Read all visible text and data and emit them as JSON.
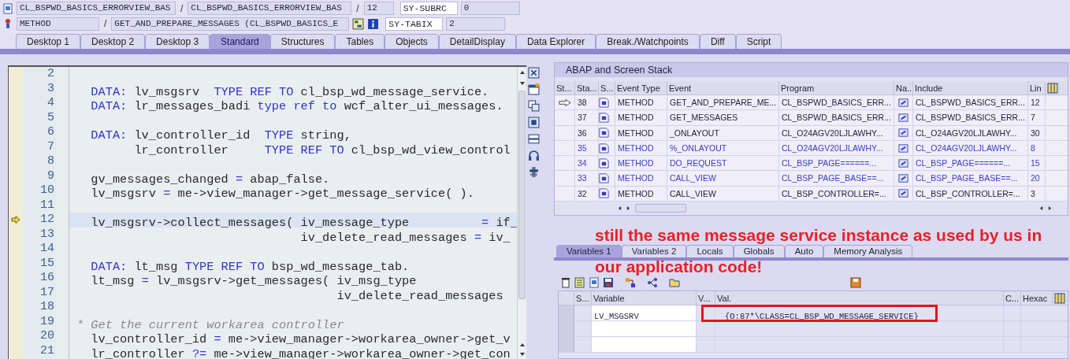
{
  "context": {
    "rows": [
      {
        "items": [
          {
            "kind": "field",
            "value": "CL_BSPWD_BASICS_ERRORVIEW_BAS"
          },
          {
            "kind": "separator",
            "value": "/"
          },
          {
            "kind": "field",
            "value": "CL_BSPWD_BASICS_ERRORVIEW_BAS"
          },
          {
            "kind": "separator",
            "value": "/"
          },
          {
            "kind": "field",
            "value": "12"
          },
          {
            "kind": "name",
            "value": "SY-SUBRC"
          },
          {
            "kind": "field",
            "value": "0"
          }
        ]
      },
      {
        "items": [
          {
            "kind": "field",
            "value": "METHOD"
          },
          {
            "kind": "separator",
            "value": "/"
          },
          {
            "kind": "field",
            "value": "GET_AND_PREPARE_MESSAGES (CL_BSPWD_BASICS_E"
          },
          {
            "kind": "tools"
          },
          {
            "kind": "name",
            "value": "SY-TABIX"
          },
          {
            "kind": "field",
            "value": "2"
          }
        ]
      }
    ]
  },
  "tabs": [
    {
      "label": "Desktop 1",
      "selected": false
    },
    {
      "label": "Desktop 2",
      "selected": false
    },
    {
      "label": "Desktop 3",
      "selected": false
    },
    {
      "label": "Standard",
      "selected": true
    },
    {
      "label": "Structures",
      "selected": false
    },
    {
      "label": "Tables",
      "selected": false
    },
    {
      "label": "Objects",
      "selected": false
    },
    {
      "label": "DetailDisplay",
      "selected": false
    },
    {
      "label": "Data Explorer",
      "selected": false
    },
    {
      "label": "Break./Watchpoints",
      "selected": false
    },
    {
      "label": "Diff",
      "selected": false
    },
    {
      "label": "Script",
      "selected": false
    }
  ],
  "editor": {
    "lines": [
      {
        "number": "2",
        "current": false
      },
      {
        "number": "3",
        "current": false,
        "segments": [
          {
            "kind": "keyword",
            "text": "  DATA:"
          },
          {
            "kind": "plain",
            "text": " lv_msgsrv  "
          },
          {
            "kind": "keyword",
            "text": "TYPE REF TO"
          },
          {
            "kind": "plain",
            "text": " cl_bsp_wd_message_service."
          }
        ]
      },
      {
        "number": "4",
        "current": false,
        "segments": [
          {
            "kind": "keyword",
            "text": "  DATA:"
          },
          {
            "kind": "plain",
            "text": " lr_messages_badi "
          },
          {
            "kind": "keyword",
            "text": "type ref to"
          },
          {
            "kind": "plain",
            "text": " wcf_alter_ui_messages."
          }
        ]
      },
      {
        "number": "5",
        "current": false
      },
      {
        "number": "6",
        "current": false,
        "segments": [
          {
            "kind": "keyword",
            "text": "  DATA:"
          },
          {
            "kind": "plain",
            "text": " lv_controller_id  "
          },
          {
            "kind": "keyword",
            "text": "TYPE"
          },
          {
            "kind": "plain",
            "text": " string,"
          }
        ]
      },
      {
        "number": "7",
        "current": false,
        "segments": [
          {
            "kind": "plain",
            "text": "        lr_controller     "
          },
          {
            "kind": "keyword",
            "text": "TYPE REF TO"
          },
          {
            "kind": "plain",
            "text": " cl_bsp_wd_view_control"
          }
        ]
      },
      {
        "number": "8",
        "current": false
      },
      {
        "number": "9",
        "current": false,
        "segments": [
          {
            "kind": "plain",
            "text": "  gv_messages_changed "
          },
          {
            "kind": "operator",
            "text": "="
          },
          {
            "kind": "plain",
            "text": " abap_false."
          }
        ]
      },
      {
        "number": "10",
        "current": false,
        "segments": [
          {
            "kind": "plain",
            "text": "  lv_msgsrv "
          },
          {
            "kind": "operator",
            "text": "="
          },
          {
            "kind": "plain",
            "text": " me->view_manager->get_message_service( )."
          }
        ]
      },
      {
        "number": "11",
        "current": false
      },
      {
        "number": "12",
        "current": true,
        "segments": [
          {
            "kind": "plain",
            "text": "  lv_msgsrv->collect_messages( iv_message_type          "
          },
          {
            "kind": "operator",
            "text": "="
          },
          {
            "kind": "plain",
            "text": " if_"
          }
        ]
      },
      {
        "number": "13",
        "current": false,
        "segments": [
          {
            "kind": "plain",
            "text": "                               iv_delete_read_messages "
          },
          {
            "kind": "operator",
            "text": "="
          },
          {
            "kind": "plain",
            "text": " iv_"
          }
        ]
      },
      {
        "number": "14",
        "current": false
      },
      {
        "number": "15",
        "current": false,
        "segments": [
          {
            "kind": "keyword",
            "text": "  DATA:"
          },
          {
            "kind": "plain",
            "text": " lt_msg "
          },
          {
            "kind": "keyword",
            "text": "TYPE REF TO"
          },
          {
            "kind": "plain",
            "text": " bsp_wd_message_tab."
          }
        ]
      },
      {
        "number": "16",
        "current": false,
        "segments": [
          {
            "kind": "plain",
            "text": "  lt_msg "
          },
          {
            "kind": "operator",
            "text": "="
          },
          {
            "kind": "plain",
            "text": " lv_msgsrv->get_messages( iv_msg_type"
          }
        ]
      },
      {
        "number": "17",
        "current": false,
        "segments": [
          {
            "kind": "plain",
            "text": "                                    iv_delete_read_messages"
          }
        ]
      },
      {
        "number": "18",
        "current": false
      },
      {
        "number": "19",
        "current": false,
        "segments": [
          {
            "kind": "comment",
            "text": "* Get the current workarea controller"
          }
        ]
      },
      {
        "number": "20",
        "current": false,
        "segments": [
          {
            "kind": "plain",
            "text": "  lv_controller_id "
          },
          {
            "kind": "operator",
            "text": "="
          },
          {
            "kind": "plain",
            "text": " me->view_manager->workarea_owner->get_v"
          }
        ]
      },
      {
        "number": "21",
        "current": false,
        "segments": [
          {
            "kind": "plain",
            "text": "  lr_controller "
          },
          {
            "kind": "operator",
            "text": "?="
          },
          {
            "kind": "plain",
            "text": " me->view_manager->workarea_owner->get_con"
          }
        ]
      }
    ]
  },
  "stack": {
    "title": "ABAP and Screen Stack",
    "columns": [
      "St...",
      "Sta...",
      "S...",
      "Event Type",
      "Event",
      "Program",
      "Na...",
      "Include",
      "Lin"
    ],
    "rows": [
      {
        "current": true,
        "color": "#1f1f3a",
        "level": "38",
        "event_type": "METHOD",
        "event": "GET_AND_PREPARE_ME...",
        "program": "CL_BSPWD_BASICS_ERR...",
        "include": "CL_BSPWD_BASICS_ERR...",
        "line": "12"
      },
      {
        "current": false,
        "color": "#1f1f3a",
        "level": "37",
        "event_type": "METHOD",
        "event": "GET_MESSAGES",
        "program": "CL_BSPWD_BASICS_ERR...",
        "include": "CL_BSPWD_BASICS_ERR...",
        "line": "7"
      },
      {
        "current": false,
        "color": "#1f1f3a",
        "level": "36",
        "event_type": "METHOD",
        "event": "_ONLAYOUT",
        "program": "CL_O24AGV20LJLAWHY...",
        "include": "CL_O24AGV20LJLAWHY...",
        "line": "30"
      },
      {
        "current": false,
        "color": "#3b3bc4",
        "level": "35",
        "event_type": "METHOD",
        "event": "%_ONLAYOUT",
        "program": "CL_O24AGV20LJLAWHY...",
        "include": "CL_O24AGV20LJLAWHY...",
        "line": "8"
      },
      {
        "current": false,
        "color": "#3b3bc4",
        "level": "34",
        "event_type": "METHOD",
        "event": "DO_REQUEST",
        "program": "CL_BSP_PAGE======...",
        "include": "CL_BSP_PAGE======...",
        "line": "15"
      },
      {
        "current": false,
        "color": "#3b3bc4",
        "level": "33",
        "event_type": "METHOD",
        "event": "CALL_VIEW",
        "program": "CL_BSP_PAGE_BASE==...",
        "include": "CL_BSP_PAGE_BASE==...",
        "line": "20"
      },
      {
        "current": false,
        "color": "#1f1f3a",
        "level": "32",
        "event_type": "METHOD",
        "event": "CALL_VIEW",
        "program": "CL_BSP_CONTROLLER=...",
        "include": "CL_BSP_CONTROLLER=...",
        "line": "3"
      }
    ]
  },
  "variables": {
    "tabs": [
      {
        "label": "Variables 1",
        "selected": true
      },
      {
        "label": "Variables 2",
        "selected": false
      },
      {
        "label": "Locals",
        "selected": false
      },
      {
        "label": "Globals",
        "selected": false
      },
      {
        "label": "Auto",
        "selected": false
      },
      {
        "label": "Memory Analysis",
        "selected": false
      }
    ],
    "columns": [
      "S...",
      "Variable",
      "V...",
      "Val.",
      "C...",
      "Hexac"
    ],
    "rows": [
      {
        "variable": "LV_MSGSRV",
        "value": "{O:87*\\CLASS=CL_BSP_WD_MESSAGE_SERVICE}",
        "highlighted": true
      }
    ]
  },
  "annotation": {
    "lines": [
      "still the same message service instance as used by us in",
      "our application code!"
    ]
  }
}
